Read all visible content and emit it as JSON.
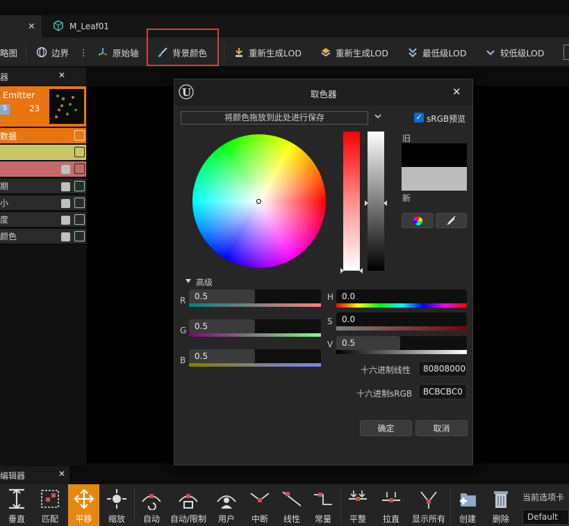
{
  "tabs": [
    {
      "label": "",
      "close": "✕"
    },
    {
      "label": "M_Leaf01",
      "close": ""
    }
  ],
  "toolbar": {
    "items": [
      {
        "label": "略图"
      },
      {
        "label": "边界"
      },
      {
        "label": "原始轴"
      },
      {
        "label": "背景颜色"
      },
      {
        "label": "重新生成LOD"
      },
      {
        "label": "重新生成LOD"
      },
      {
        "label": "最低级LOD"
      },
      {
        "label": "较低级LOD"
      }
    ]
  },
  "left_panel": {
    "title": "器",
    "close": "✕",
    "emitter_name": "Emitter",
    "emitter_badge": "S",
    "emitter_count": "23",
    "rows": [
      {
        "label": "数据",
        "color": "#e8750f"
      },
      {
        "label": "",
        "color": "#c9c66a"
      },
      {
        "label": "",
        "color": "#c46a6a"
      },
      {
        "label": "期",
        "color": "#2a2a2a"
      },
      {
        "label": "小",
        "color": "#2a2a2a"
      },
      {
        "label": "度",
        "color": "#2a2a2a"
      },
      {
        "label": "颜色",
        "color": "#2a2a2a"
      }
    ]
  },
  "color_picker": {
    "title": "取色器",
    "close": "✕",
    "save_drop_text": "将颜色拖放到此处进行保存",
    "srgb_label": "sRGB预览",
    "srgb_checked": true,
    "old_label": "旧",
    "new_label": "新",
    "advanced_label": "高级",
    "r": {
      "label": "R",
      "value": "0.5"
    },
    "g": {
      "label": "G",
      "value": "0.5"
    },
    "b": {
      "label": "B",
      "value": "0.5"
    },
    "h": {
      "label": "H",
      "value": "0.0"
    },
    "s": {
      "label": "S",
      "value": "0.0"
    },
    "v": {
      "label": "V",
      "value": "0.5"
    },
    "hex_linear_label": "十六进制线性",
    "hex_linear_value": "80808000",
    "hex_srgb_label": "十六进制sRGB",
    "hex_srgb_value": "BCBCBC0",
    "ok_label": "确定",
    "cancel_label": "取消",
    "old_color": "#000000",
    "new_color": "#bcbcbc"
  },
  "bottom": {
    "title": "编辑器",
    "close": "✕",
    "buttons": [
      {
        "label": "垂直"
      },
      {
        "label": "匹配"
      },
      {
        "label": "平移"
      },
      {
        "label": "缩放"
      },
      {
        "label": "自动"
      },
      {
        "label": "自动/限制"
      },
      {
        "label": "用户"
      },
      {
        "label": "中断"
      },
      {
        "label": "线性"
      },
      {
        "label": "常量"
      },
      {
        "label": "平整"
      },
      {
        "label": "拉直"
      },
      {
        "label": "显示所有"
      },
      {
        "label": "创建"
      },
      {
        "label": "删除"
      }
    ],
    "current_tab_label": "当前选项卡",
    "current_tab_value": "Default"
  }
}
